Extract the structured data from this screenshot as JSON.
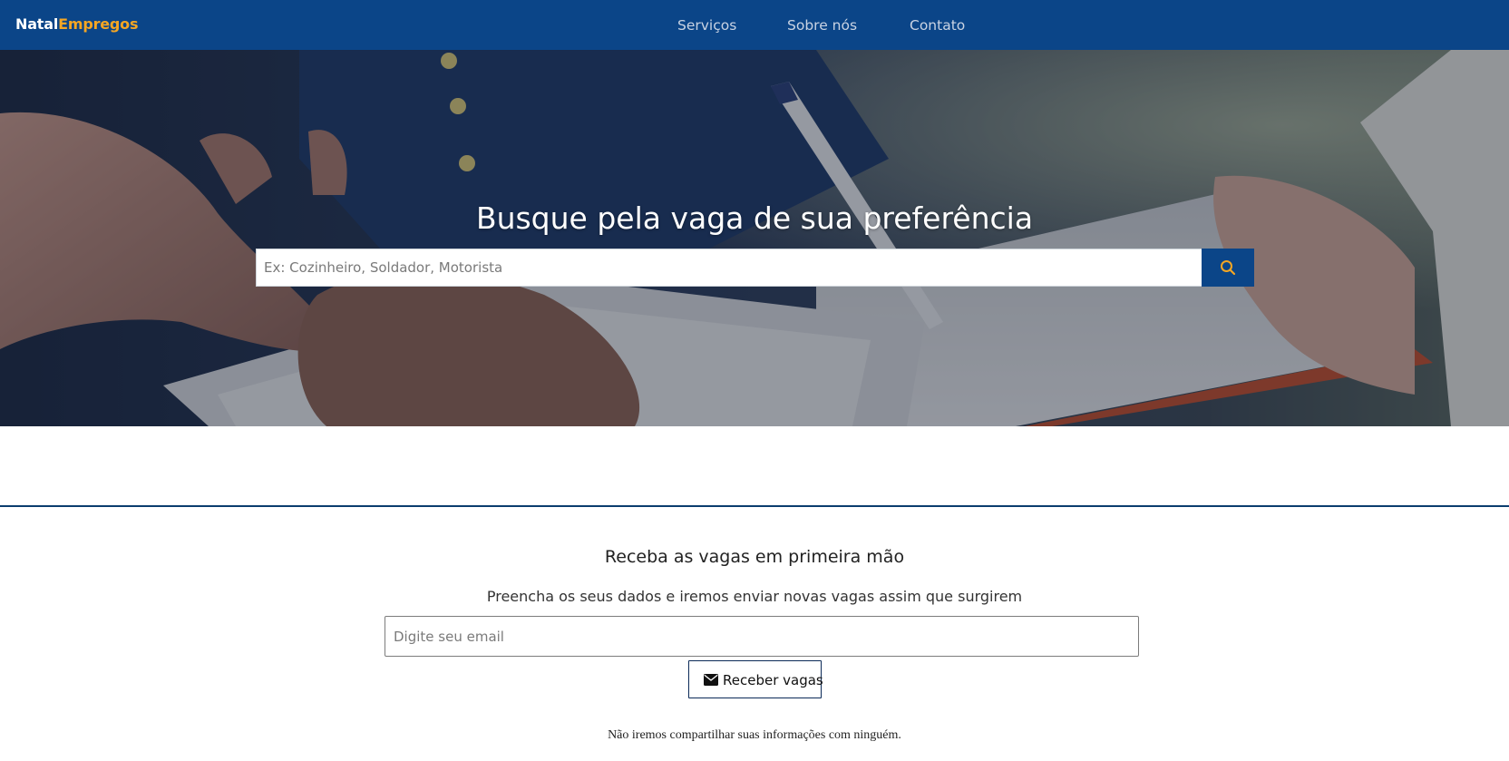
{
  "navbar": {
    "brand_part1": "Natal",
    "brand_part2": "Empregos",
    "links": [
      {
        "label": "Serviços"
      },
      {
        "label": "Sobre nós"
      },
      {
        "label": "Contato"
      }
    ],
    "colors": {
      "background": "#0b4588",
      "brand_accent": "#f5a623"
    }
  },
  "hero": {
    "title": "Busque pela vaga de sua preferência",
    "search": {
      "placeholder": "Ex: Cozinheiro, Soldador, Motorista",
      "value": "",
      "button_icon": "search-icon"
    }
  },
  "newsletter": {
    "title": "Receba as vagas em primeira mão",
    "subtitle": "Preencha os seus dados e iremos enviar novas vagas assim que surgirem",
    "email_placeholder": "Digite seu email",
    "email_value": "",
    "button_label": "Receber vagas",
    "button_icon": "envelope-icon",
    "privacy_note": "Não iremos compartilhar suas informações com ninguém."
  }
}
